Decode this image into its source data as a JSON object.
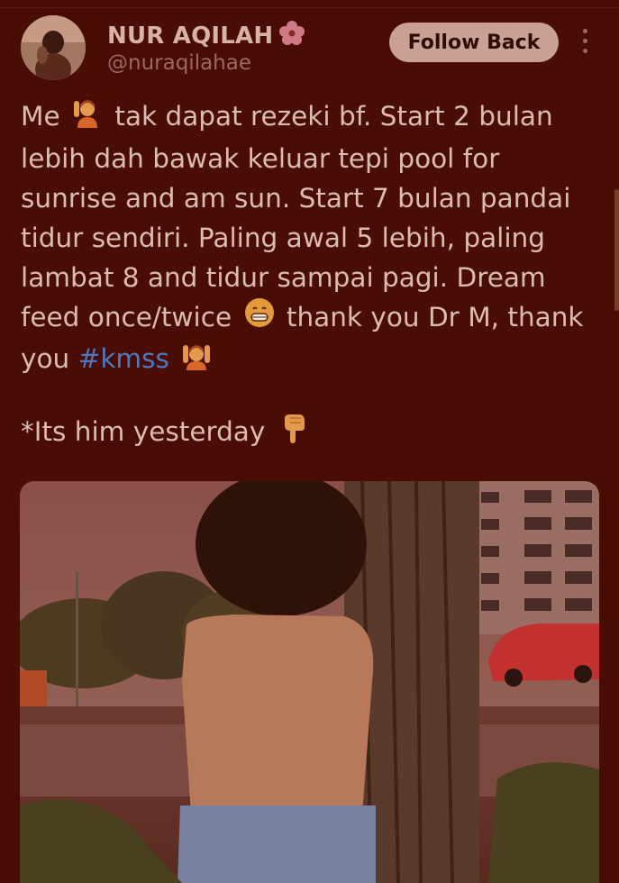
{
  "user": {
    "display_name": "NUR AQILAH",
    "name_badge_icon": "hibiscus-icon",
    "handle": "@nuraqilahae"
  },
  "actions": {
    "follow_label": "Follow Back",
    "more_icon": "more-vertical-icon"
  },
  "tweet": {
    "lines": [
      "Me",
      "tak dapat rezeki bf. Start 2 bulan",
      "lebih dah bawak keluar tepi pool for",
      "sunrise and am sun. Start 7 bulan pandai",
      "tidur sendiri. Paling awal 5 lebih, paling",
      "lambat 8 and tidur sampai pagi. Dream",
      "feed once/twice",
      "thank you Dr M, thank",
      "you",
      "#kmss"
    ],
    "footnote": "*Its him yesterday",
    "emojis": [
      "raising-hand-icon",
      "grinning-icon",
      "raising-hands-icon",
      "pointing-down-icon"
    ]
  },
  "media": {
    "icon": "photo-icon"
  },
  "colors": {
    "background": "#4a0d04",
    "text": "#dcbcb0",
    "hashtag": "#4e78c2",
    "button": "#caa092"
  }
}
